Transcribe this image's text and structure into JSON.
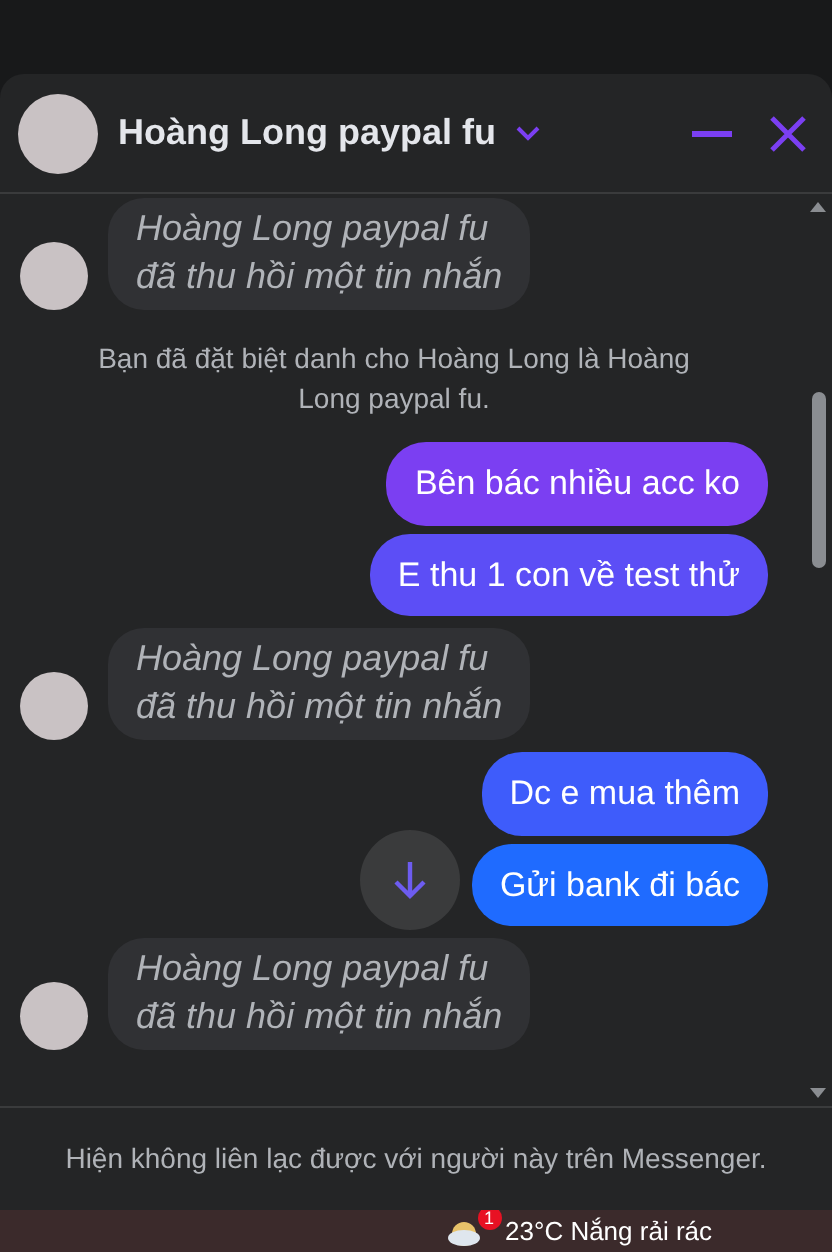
{
  "chat": {
    "title": "Hoàng Long paypal fu"
  },
  "messages": [
    {
      "kind": "unsent",
      "lines": [
        "Hoàng Long paypal fu",
        "đã thu hồi một tin nhắn"
      ]
    },
    {
      "kind": "notice",
      "text": "Bạn đã đặt biệt danh cho Hoàng Long là Hoàng Long paypal fu."
    },
    {
      "kind": "outgoing",
      "text": "Bên bác nhiều acc ko"
    },
    {
      "kind": "outgoing",
      "text": "E thu 1 con về test thử"
    },
    {
      "kind": "unsent",
      "lines": [
        "Hoàng Long paypal fu",
        "đã thu hồi một tin nhắn"
      ]
    },
    {
      "kind": "outgoing",
      "text": "Dc e mua thêm"
    },
    {
      "kind": "outgoing",
      "text": "Gửi bank đi bác"
    },
    {
      "kind": "unsent",
      "lines": [
        "Hoàng Long paypal fu",
        "đã thu hồi một tin nhắn"
      ]
    }
  ],
  "footer": {
    "text": "Hiện không liên lạc được với người này trên Messenger."
  },
  "taskbar": {
    "badge": "1",
    "weather": "23°C  Nắng rải rác"
  }
}
